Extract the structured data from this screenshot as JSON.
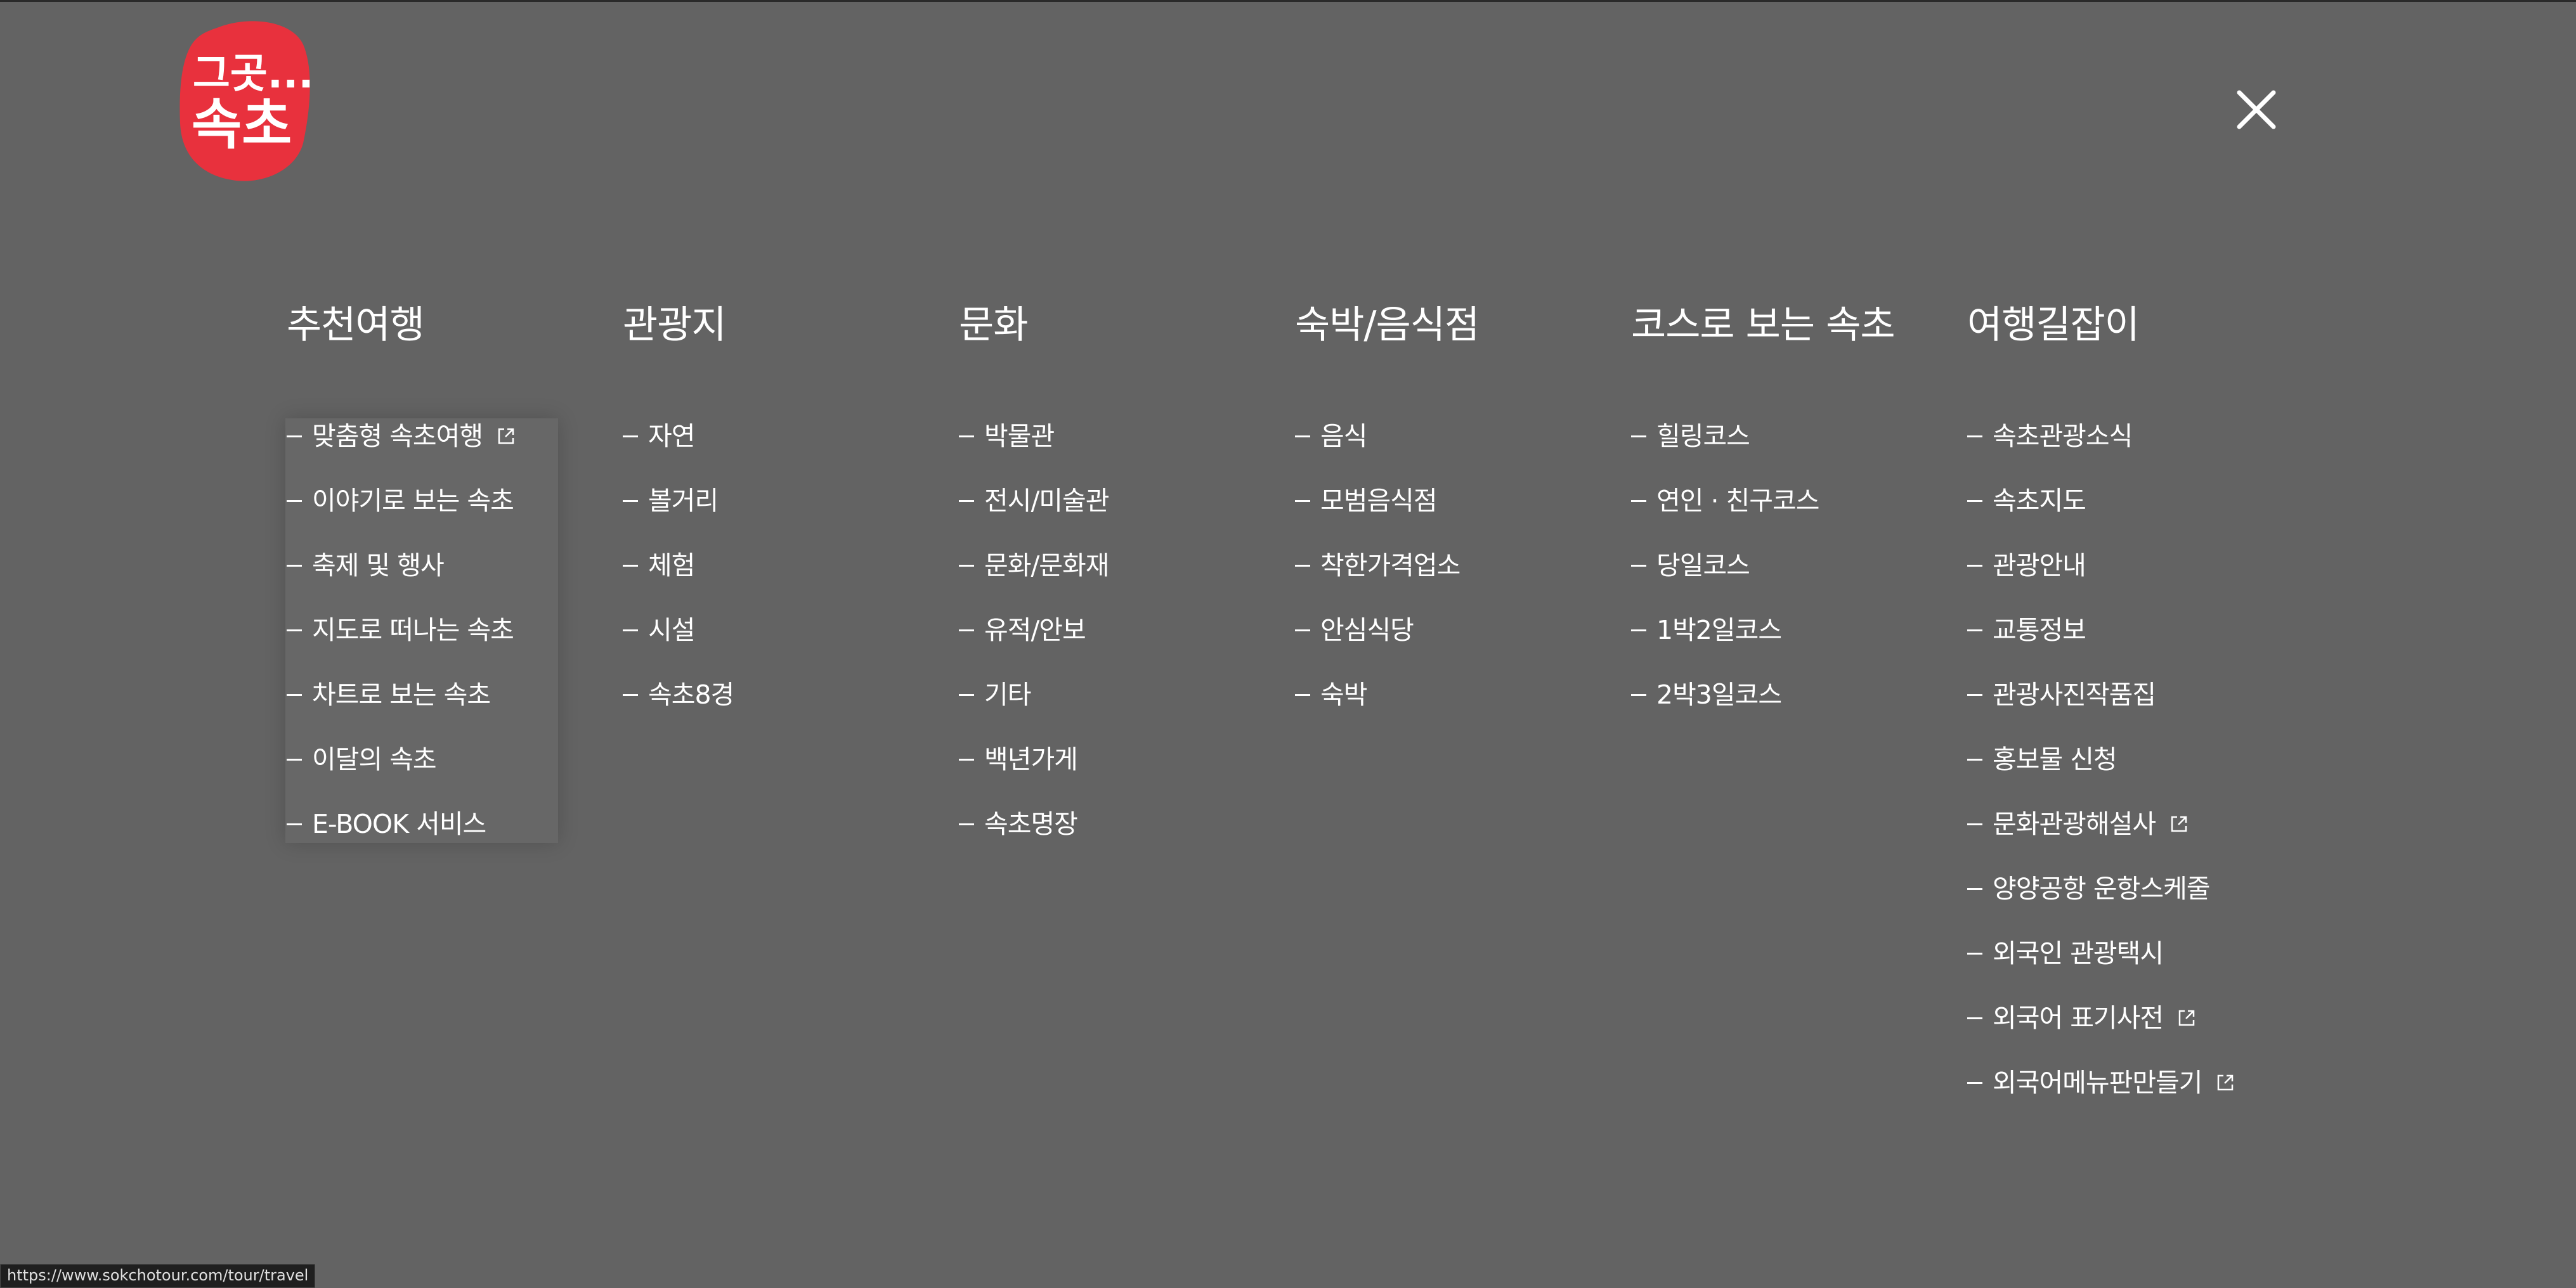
{
  "logo": {
    "line1": "그곳...",
    "line2": "속초",
    "color": "#e8313d"
  },
  "close_button": {
    "icon": "close-icon"
  },
  "menu": [
    {
      "title": "추천여행",
      "items": [
        {
          "label": "맞춤형 속초여행",
          "external": true
        },
        {
          "label": "이야기로 보는 속초"
        },
        {
          "label": "축제 및 행사"
        },
        {
          "label": "지도로 떠나는 속초"
        },
        {
          "label": "차트로 보는 속초"
        },
        {
          "label": "이달의 속초"
        },
        {
          "label": "E-BOOK 서비스"
        }
      ]
    },
    {
      "title": "관광지",
      "items": [
        {
          "label": "자연"
        },
        {
          "label": "볼거리"
        },
        {
          "label": "체험"
        },
        {
          "label": "시설"
        },
        {
          "label": "속초8경"
        }
      ]
    },
    {
      "title": "문화",
      "items": [
        {
          "label": "박물관"
        },
        {
          "label": "전시/미술관"
        },
        {
          "label": "문화/문화재"
        },
        {
          "label": "유적/안보"
        },
        {
          "label": "기타"
        },
        {
          "label": "백년가게"
        },
        {
          "label": "속초명장"
        }
      ]
    },
    {
      "title": "숙박/음식점",
      "items": [
        {
          "label": "음식"
        },
        {
          "label": "모범음식점"
        },
        {
          "label": "착한가격업소"
        },
        {
          "label": "안심식당"
        },
        {
          "label": "숙박"
        }
      ]
    },
    {
      "title": "코스로 보는 속초",
      "items": [
        {
          "label": "힐링코스"
        },
        {
          "label": "연인 · 친구코스"
        },
        {
          "label": "당일코스"
        },
        {
          "label": "1박2일코스"
        },
        {
          "label": "2박3일코스"
        }
      ]
    },
    {
      "title": "여행길잡이",
      "items": [
        {
          "label": "속초관광소식"
        },
        {
          "label": "속초지도"
        },
        {
          "label": "관광안내"
        },
        {
          "label": "교통정보"
        },
        {
          "label": "관광사진작품집"
        },
        {
          "label": "홍보물 신청"
        },
        {
          "label": "문화관광해설사",
          "external": true
        },
        {
          "label": "양양공항 운항스케줄"
        },
        {
          "label": "외국인 관광택시"
        },
        {
          "label": "외국어 표기사전",
          "external": true
        },
        {
          "label": "외국어메뉴판만들기",
          "external": true
        }
      ]
    }
  ],
  "status_bar": {
    "url": "https://www.sokchotour.com/tour/travel"
  },
  "colors": {
    "overlay_background": "#636363",
    "text": "#ffffff"
  }
}
